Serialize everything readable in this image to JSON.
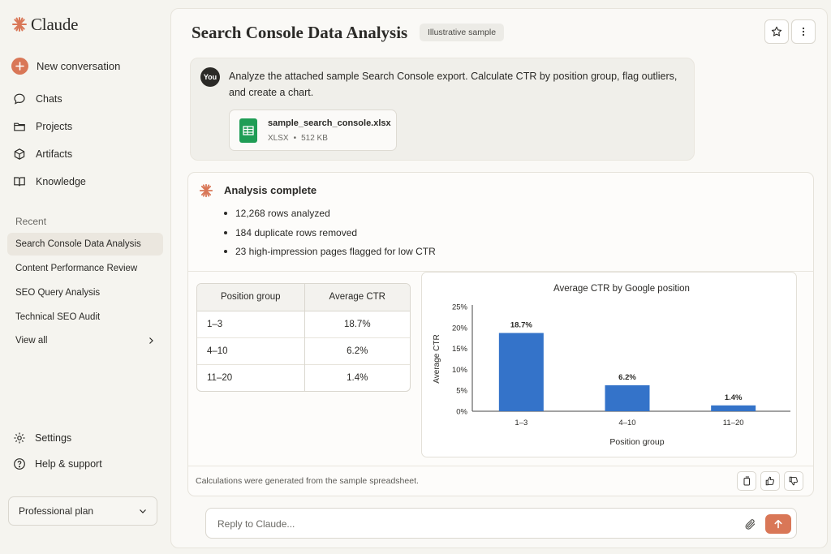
{
  "sidebar": {
    "app_name": "Claude",
    "new_conversation": "New conversation",
    "nav": [
      "Chats",
      "Projects",
      "Artifacts",
      "Knowledge"
    ],
    "recent_heading": "Recent",
    "recent": [
      "Search Console Data Analysis",
      "Content Performance Review",
      "SEO Query Analysis",
      "Technical SEO Audit"
    ],
    "view_all": "View all",
    "settings": "Settings",
    "help": "Help & support",
    "plan": "Professional plan"
  },
  "header": {
    "title": "Search Console Data Analysis",
    "badge": "Illustrative sample"
  },
  "user_message": {
    "avatar": "You",
    "text": "Analyze the attached sample Search Console export. Calculate CTR by position group, flag outliers, and create a chart.",
    "file": {
      "name": "sample_search_console.xlsx",
      "type": "XLSX",
      "separator": "•",
      "size": "512 KB"
    }
  },
  "assistant": {
    "title": "Analysis complete",
    "bullets": [
      "12,268 rows analyzed",
      "184 duplicate rows removed",
      "23 high-impression pages flagged for low CTR"
    ],
    "table": {
      "headers": [
        "Position group",
        "Average CTR"
      ],
      "rows": [
        [
          "1–3",
          "18.7%"
        ],
        [
          "4–10",
          "6.2%"
        ],
        [
          "11–20",
          "1.4%"
        ]
      ]
    },
    "footer_note": "Calculations were generated from the sample spreadsheet."
  },
  "chart_data": {
    "type": "bar",
    "title": "Average CTR by Google position",
    "xlabel": "Position group",
    "ylabel": "Average CTR",
    "categories": [
      "1–3",
      "4–10",
      "11–20"
    ],
    "values": [
      18.7,
      6.2,
      1.4
    ],
    "data_labels": [
      "18.7%",
      "6.2%",
      "1.4%"
    ],
    "ylim": [
      0,
      25
    ],
    "yticks": [
      0,
      5,
      10,
      15,
      20,
      25
    ],
    "ytick_labels": [
      "0%",
      "5%",
      "10%",
      "15%",
      "20%",
      "25%"
    ],
    "bar_color": "#3473c9",
    "grid": false,
    "legend": "none"
  },
  "reply": {
    "placeholder": "Reply to Claude..."
  },
  "colors": {
    "accent": "#d97757",
    "file_icon": "#1f9d55"
  }
}
